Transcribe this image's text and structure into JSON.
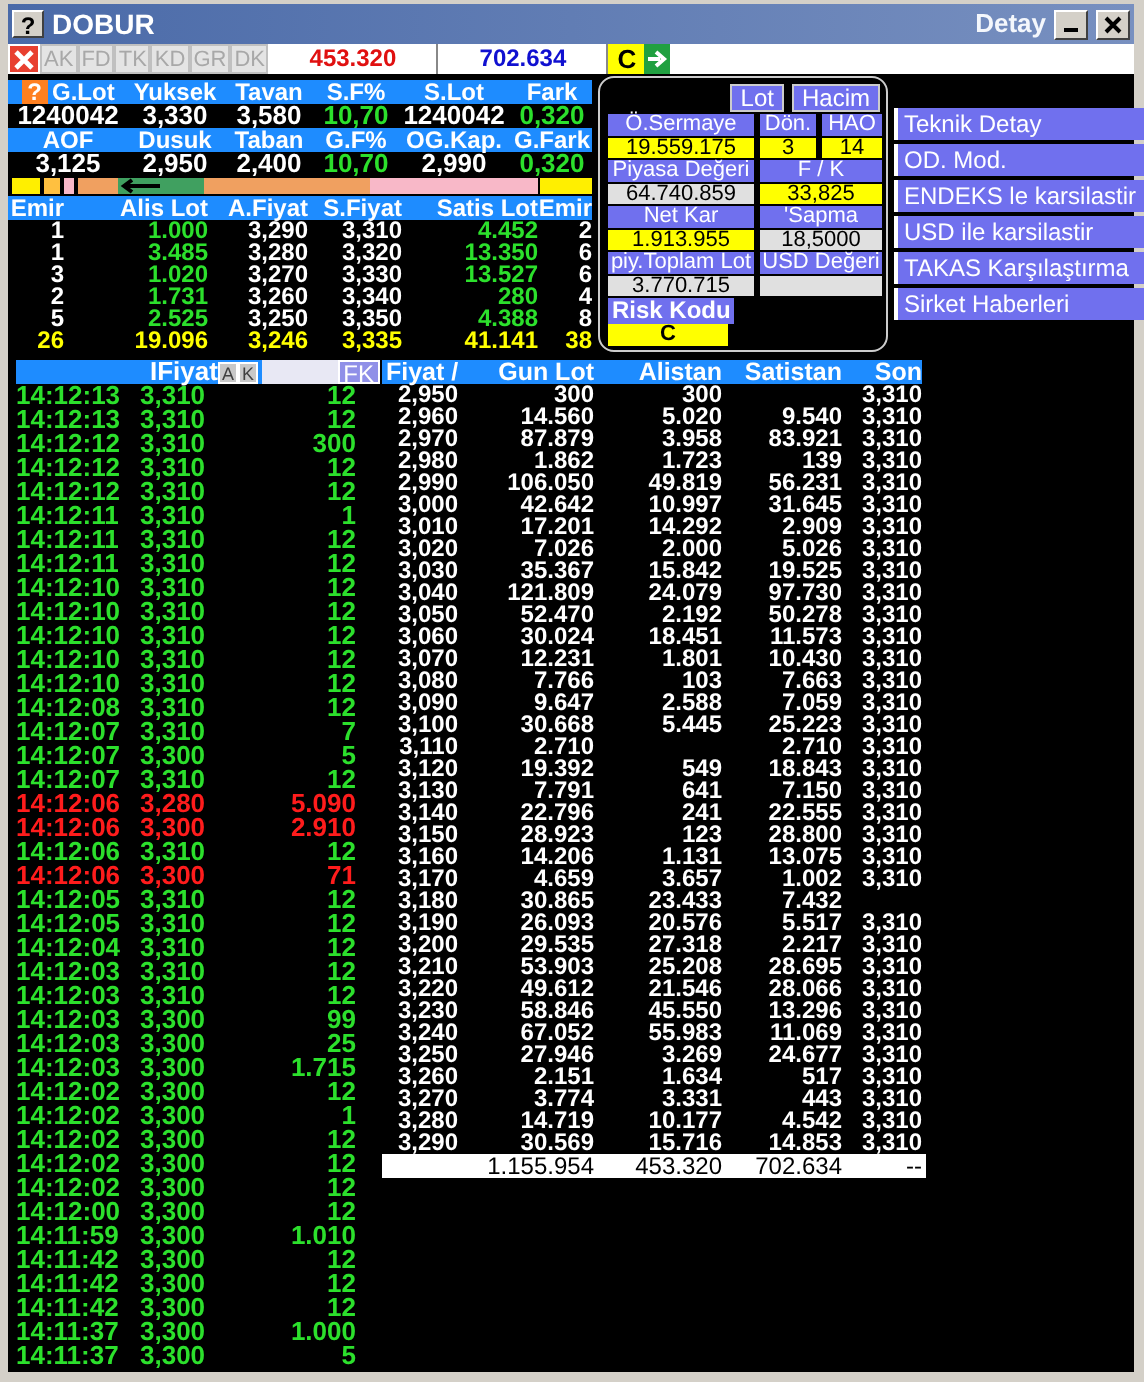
{
  "window": {
    "help_label": "?",
    "title": "DOBUR",
    "detail_title": "Detay"
  },
  "toolbar": {
    "buttons": [
      {
        "label": "AK",
        "disabled": true
      },
      {
        "label": "FD",
        "disabled": true
      },
      {
        "label": "TK",
        "disabled": true
      },
      {
        "label": "KD",
        "disabled": true
      },
      {
        "label": "GR",
        "disabled": true
      },
      {
        "label": "DK",
        "disabled": true
      }
    ],
    "buy_total": "453.320",
    "sell_total": "702.634",
    "code": "C"
  },
  "summary": {
    "help_label": "?",
    "rows": [
      [
        {
          "label": "G.Lot",
          "value": "1240042",
          "kind": "plain"
        },
        {
          "label": "Yuksek",
          "value": "3,330",
          "kind": "plain"
        },
        {
          "label": "Tavan",
          "value": "3,580",
          "kind": "plain"
        },
        {
          "label": "S.F%",
          "value": "10,70",
          "kind": "change"
        },
        {
          "label": "S.Lot",
          "value": "1240042",
          "kind": "plain"
        },
        {
          "label": "Fark",
          "value": "0,320",
          "kind": "change"
        }
      ],
      [
        {
          "label": "AOF",
          "value": "3,125",
          "kind": "plain"
        },
        {
          "label": "Dusuk",
          "value": "2,950",
          "kind": "plain"
        },
        {
          "label": "Taban",
          "value": "2,400",
          "kind": "plain"
        },
        {
          "label": "G.F%",
          "value": "10,70",
          "kind": "change"
        },
        {
          "label": "OG.Kap.",
          "value": "2,990",
          "kind": "plain"
        },
        {
          "label": "G.Fark",
          "value": "0,320",
          "kind": "change"
        }
      ]
    ]
  },
  "order_book": {
    "columns": [
      "Emir",
      "Alis Lot",
      "A.Fiyat",
      "S.Fiyat",
      "Satis Lot",
      "Emir"
    ],
    "rows": [
      [
        "1",
        "1.000",
        "3,290",
        "3,310",
        "4.452",
        "2"
      ],
      [
        "1",
        "3.485",
        "3,280",
        "3,320",
        "13.350",
        "6"
      ],
      [
        "3",
        "1.020",
        "3,270",
        "3,330",
        "13.527",
        "6"
      ],
      [
        "2",
        "1.731",
        "3,260",
        "3,340",
        "280",
        "4"
      ],
      [
        "5",
        "2.525",
        "3,250",
        "3,350",
        "4.388",
        "8"
      ]
    ],
    "totals": [
      "26",
      "19.096",
      "3,246",
      "3,335",
      "41.141",
      "38"
    ]
  },
  "stats_panel": {
    "buttons": [
      "Lot",
      "Hacim"
    ],
    "rows": [
      [
        {
          "label": "Ö.Sermaye",
          "value": "19.559.175",
          "highlight": true
        },
        {
          "label": "Dön.",
          "value": "3",
          "highlight": true
        },
        {
          "label": "HAO",
          "value": "14",
          "highlight": true
        }
      ],
      [
        {
          "label": "Piyasa Değeri",
          "value": "64.740.859",
          "highlight": false
        },
        {
          "label": "F / K",
          "value": "33,825",
          "highlight": true
        }
      ],
      [
        {
          "label": "Net Kar",
          "value": "1.913.955",
          "highlight": true
        },
        {
          "label": "'Sapma",
          "value": "18,5000",
          "highlight": false
        }
      ],
      [
        {
          "label": "piy.Toplam Lot",
          "value": "3.770.715",
          "highlight": false
        },
        {
          "label": "USD Değeri",
          "highlight": false
        }
      ]
    ],
    "risk": {
      "label": "Risk Kodu",
      "value": "C"
    }
  },
  "menu": [
    "Teknik Detay",
    "OD. Mod.",
    "ENDEKS le karsilastir",
    "USD ile karsilastir",
    "TAKAS Karşılaştırma",
    "Sirket Haberleri"
  ],
  "trades": {
    "price_label": "IFiyat",
    "buttons": [
      "A",
      "K"
    ],
    "filter_button": "FK",
    "rows": [
      {
        "time": "14:12:13",
        "price": "3,310",
        "lot": "12",
        "kind": "up"
      },
      {
        "time": "14:12:13",
        "price": "3,310",
        "lot": "12",
        "kind": "up"
      },
      {
        "time": "14:12:12",
        "price": "3,310",
        "lot": "300",
        "kind": "up"
      },
      {
        "time": "14:12:12",
        "price": "3,310",
        "lot": "12",
        "kind": "up"
      },
      {
        "time": "14:12:12",
        "price": "3,310",
        "lot": "12",
        "kind": "up"
      },
      {
        "time": "14:12:11",
        "price": "3,310",
        "lot": "1",
        "kind": "up"
      },
      {
        "time": "14:12:11",
        "price": "3,310",
        "lot": "12",
        "kind": "up"
      },
      {
        "time": "14:12:11",
        "price": "3,310",
        "lot": "12",
        "kind": "up"
      },
      {
        "time": "14:12:10",
        "price": "3,310",
        "lot": "12",
        "kind": "up"
      },
      {
        "time": "14:12:10",
        "price": "3,310",
        "lot": "12",
        "kind": "up"
      },
      {
        "time": "14:12:10",
        "price": "3,310",
        "lot": "12",
        "kind": "up"
      },
      {
        "time": "14:12:10",
        "price": "3,310",
        "lot": "12",
        "kind": "up"
      },
      {
        "time": "14:12:10",
        "price": "3,310",
        "lot": "12",
        "kind": "up"
      },
      {
        "time": "14:12:08",
        "price": "3,310",
        "lot": "12",
        "kind": "up"
      },
      {
        "time": "14:12:07",
        "price": "3,310",
        "lot": "7",
        "kind": "up"
      },
      {
        "time": "14:12:07",
        "price": "3,300",
        "lot": "5",
        "kind": "up"
      },
      {
        "time": "14:12:07",
        "price": "3,310",
        "lot": "12",
        "kind": "up"
      },
      {
        "time": "14:12:06",
        "price": "3,280",
        "lot": "5.090",
        "kind": "down"
      },
      {
        "time": "14:12:06",
        "price": "3,300",
        "lot": "2.910",
        "kind": "down"
      },
      {
        "time": "14:12:06",
        "price": "3,310",
        "lot": "12",
        "kind": "up"
      },
      {
        "time": "14:12:06",
        "price": "3,300",
        "lot": "71",
        "kind": "down"
      },
      {
        "time": "14:12:05",
        "price": "3,310",
        "lot": "12",
        "kind": "up"
      },
      {
        "time": "14:12:05",
        "price": "3,310",
        "lot": "12",
        "kind": "up"
      },
      {
        "time": "14:12:04",
        "price": "3,310",
        "lot": "12",
        "kind": "up"
      },
      {
        "time": "14:12:03",
        "price": "3,310",
        "lot": "12",
        "kind": "up"
      },
      {
        "time": "14:12:03",
        "price": "3,310",
        "lot": "12",
        "kind": "up"
      },
      {
        "time": "14:12:03",
        "price": "3,300",
        "lot": "99",
        "kind": "up"
      },
      {
        "time": "14:12:03",
        "price": "3,300",
        "lot": "25",
        "kind": "up"
      },
      {
        "time": "14:12:03",
        "price": "3,300",
        "lot": "1.715",
        "kind": "up"
      },
      {
        "time": "14:12:02",
        "price": "3,300",
        "lot": "12",
        "kind": "up"
      },
      {
        "time": "14:12:02",
        "price": "3,300",
        "lot": "1",
        "kind": "up"
      },
      {
        "time": "14:12:02",
        "price": "3,300",
        "lot": "12",
        "kind": "up"
      },
      {
        "time": "14:12:02",
        "price": "3,300",
        "lot": "12",
        "kind": "up"
      },
      {
        "time": "14:12:02",
        "price": "3,300",
        "lot": "12",
        "kind": "up"
      },
      {
        "time": "14:12:00",
        "price": "3,300",
        "lot": "12",
        "kind": "up"
      },
      {
        "time": "14:11:59",
        "price": "3,300",
        "lot": "1.010",
        "kind": "up"
      },
      {
        "time": "14:11:42",
        "price": "3,300",
        "lot": "12",
        "kind": "up"
      },
      {
        "time": "14:11:42",
        "price": "3,300",
        "lot": "12",
        "kind": "up"
      },
      {
        "time": "14:11:42",
        "price": "3,300",
        "lot": "12",
        "kind": "up"
      },
      {
        "time": "14:11:37",
        "price": "3,300",
        "lot": "1.000",
        "kind": "up"
      },
      {
        "time": "14:11:37",
        "price": "3,300",
        "lot": "5",
        "kind": "up"
      }
    ]
  },
  "price_table": {
    "columns": [
      "Fiyat /",
      "Gun Lot",
      "Alistan",
      "Satistan",
      "Son"
    ],
    "rows": [
      [
        "2,950",
        "300",
        "300",
        "",
        "3,310"
      ],
      [
        "2,960",
        "14.560",
        "5.020",
        "9.540",
        "3,310"
      ],
      [
        "2,970",
        "87.879",
        "3.958",
        "83.921",
        "3,310"
      ],
      [
        "2,980",
        "1.862",
        "1.723",
        "139",
        "3,310"
      ],
      [
        "2,990",
        "106.050",
        "49.819",
        "56.231",
        "3,310"
      ],
      [
        "3,000",
        "42.642",
        "10.997",
        "31.645",
        "3,310"
      ],
      [
        "3,010",
        "17.201",
        "14.292",
        "2.909",
        "3,310"
      ],
      [
        "3,020",
        "7.026",
        "2.000",
        "5.026",
        "3,310"
      ],
      [
        "3,030",
        "35.367",
        "15.842",
        "19.525",
        "3,310"
      ],
      [
        "3,040",
        "121.809",
        "24.079",
        "97.730",
        "3,310"
      ],
      [
        "3,050",
        "52.470",
        "2.192",
        "50.278",
        "3,310"
      ],
      [
        "3,060",
        "30.024",
        "18.451",
        "11.573",
        "3,310"
      ],
      [
        "3,070",
        "12.231",
        "1.801",
        "10.430",
        "3,310"
      ],
      [
        "3,080",
        "7.766",
        "103",
        "7.663",
        "3,310"
      ],
      [
        "3,090",
        "9.647",
        "2.588",
        "7.059",
        "3,310"
      ],
      [
        "3,100",
        "30.668",
        "5.445",
        "25.223",
        "3,310"
      ],
      [
        "3,110",
        "2.710",
        "",
        "2.710",
        "3,310"
      ],
      [
        "3,120",
        "19.392",
        "549",
        "18.843",
        "3,310"
      ],
      [
        "3,130",
        "7.791",
        "641",
        "7.150",
        "3,310"
      ],
      [
        "3,140",
        "22.796",
        "241",
        "22.555",
        "3,310"
      ],
      [
        "3,150",
        "28.923",
        "123",
        "28.800",
        "3,310"
      ],
      [
        "3,160",
        "14.206",
        "1.131",
        "13.075",
        "3,310"
      ],
      [
        "3,170",
        "4.659",
        "3.657",
        "1.002",
        "3,310"
      ],
      [
        "3,180",
        "30.865",
        "23.433",
        "7.432",
        ""
      ],
      [
        "3,190",
        "26.093",
        "20.576",
        "5.517",
        "3,310"
      ],
      [
        "3,200",
        "29.535",
        "27.318",
        "2.217",
        "3,310"
      ],
      [
        "3,210",
        "53.903",
        "25.208",
        "28.695",
        "3,310"
      ],
      [
        "3,220",
        "49.612",
        "21.546",
        "28.066",
        "3,310"
      ],
      [
        "3,230",
        "58.846",
        "45.550",
        "13.296",
        "3,310"
      ],
      [
        "3,240",
        "67.052",
        "55.983",
        "11.069",
        "3,310"
      ],
      [
        "3,250",
        "27.946",
        "3.269",
        "24.677",
        "3,310"
      ],
      [
        "3,260",
        "2.151",
        "1.634",
        "517",
        "3,310"
      ],
      [
        "3,270",
        "3.774",
        "3.331",
        "443",
        "3,310"
      ],
      [
        "3,280",
        "14.719",
        "10.177",
        "4.542",
        "3,310"
      ],
      [
        "3,290",
        "30.569",
        "15.716",
        "14.853",
        "3,310"
      ]
    ],
    "totals": [
      "1.155.954",
      "453.320",
      "702.634",
      "--"
    ]
  }
}
